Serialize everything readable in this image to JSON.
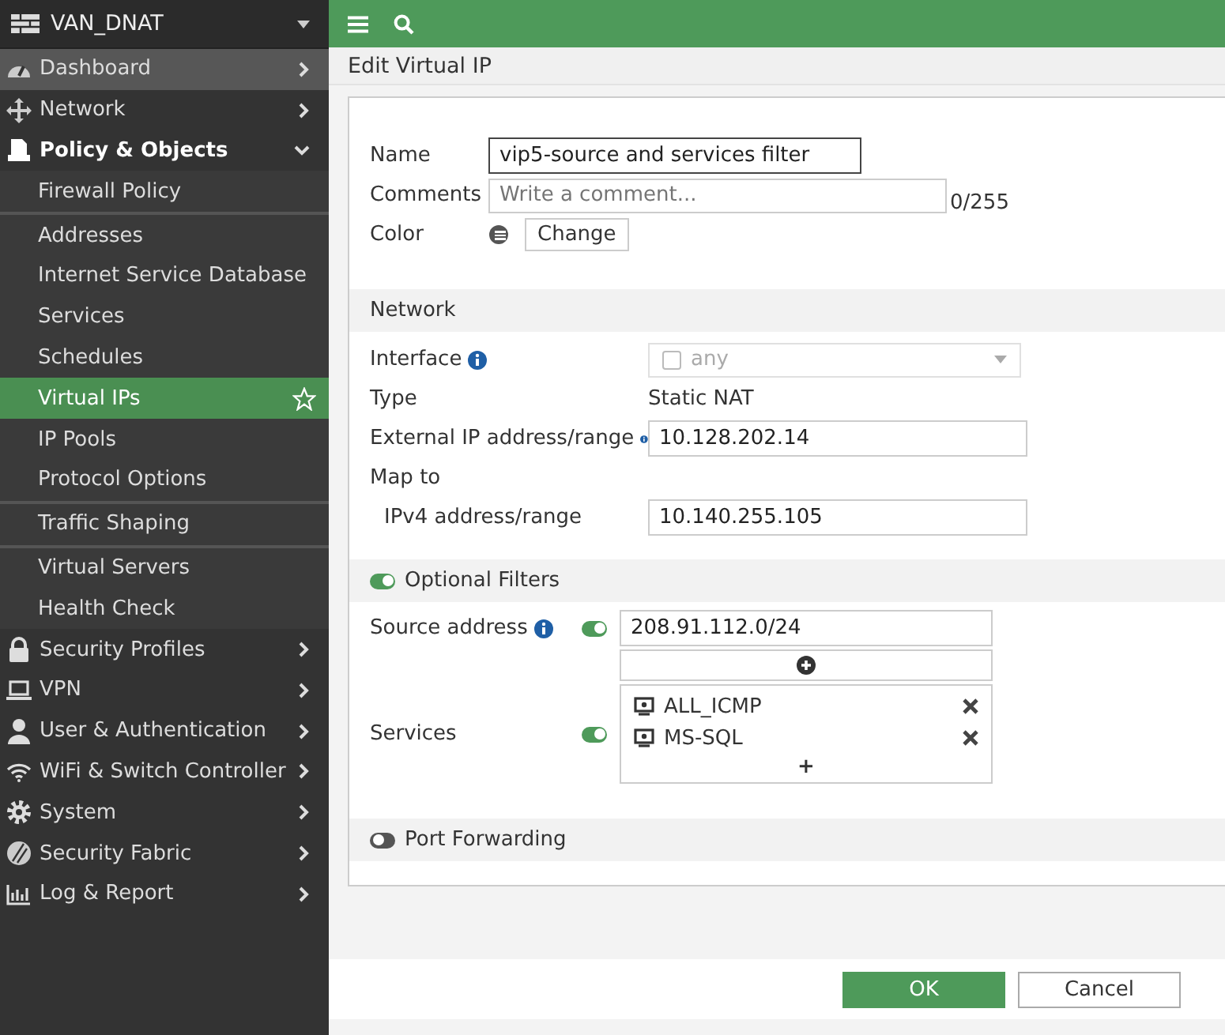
{
  "sidebar": {
    "device": "VAN_DNAT",
    "items": [
      {
        "label": "Dashboard",
        "hovered": true,
        "expanded": false,
        "selected": false
      },
      {
        "label": "Network",
        "hovered": false,
        "expanded": false,
        "selected": false
      },
      {
        "label": "Policy & Objects",
        "hovered": false,
        "expanded": true,
        "selected": false,
        "groups": [
          [
            {
              "label": "Firewall Policy",
              "selected": false
            }
          ],
          [
            {
              "label": "Addresses",
              "selected": false
            },
            {
              "label": "Internet Service Database",
              "selected": false
            },
            {
              "label": "Services",
              "selected": false
            },
            {
              "label": "Schedules",
              "selected": false
            },
            {
              "label": "Virtual IPs",
              "selected": true
            },
            {
              "label": "IP Pools",
              "selected": false
            },
            {
              "label": "Protocol Options",
              "selected": false
            }
          ],
          [
            {
              "label": "Traffic Shaping",
              "selected": false
            }
          ],
          [
            {
              "label": "Virtual Servers",
              "selected": false
            },
            {
              "label": "Health Check",
              "selected": false
            }
          ]
        ]
      },
      {
        "label": "Security Profiles",
        "hovered": false,
        "expanded": false,
        "selected": false
      },
      {
        "label": "VPN",
        "hovered": false,
        "expanded": false,
        "selected": false
      },
      {
        "label": "User & Authentication",
        "hovered": false,
        "expanded": false,
        "selected": false
      },
      {
        "label": "WiFi & Switch Controller",
        "hovered": false,
        "expanded": false,
        "selected": false
      },
      {
        "label": "System",
        "hovered": false,
        "expanded": false,
        "selected": false
      },
      {
        "label": "Security Fabric",
        "hovered": false,
        "expanded": false,
        "selected": false
      },
      {
        "label": "Log & Report",
        "hovered": false,
        "expanded": false,
        "selected": false
      }
    ]
  },
  "page_title": "Edit Virtual IP",
  "general": {
    "name_label": "Name",
    "name_value": "vip5-source and services filter",
    "comments_label": "Comments",
    "comments_placeholder": "Write a comment...",
    "comments_counter": "0/255",
    "color_label": "Color",
    "color_button": "Change"
  },
  "network": {
    "title": "Network",
    "interface_label": "Interface",
    "interface_value": "any",
    "interface_disabled": true,
    "interface_checked": false,
    "type_label": "Type",
    "type_value": "Static NAT",
    "external_label": "External IP address/range",
    "external_value": "10.128.202.14",
    "map_label": "Map to",
    "ipv4_label": "IPv4 address/range",
    "ipv4_value": "10.140.255.105"
  },
  "optional_filters": {
    "title": "Optional Filters",
    "on": true,
    "source_label": "Source address",
    "source_on": true,
    "source_values": [
      "208.91.112.0/24"
    ],
    "services_label": "Services",
    "services_on": true,
    "services": [
      "ALL_ICMP",
      "MS-SQL"
    ],
    "add_symbol": "+"
  },
  "port_forwarding": {
    "title": "Port Forwarding",
    "on": false
  },
  "buttons": [
    {
      "label": "OK",
      "primary": true
    },
    {
      "label": "Cancel",
      "primary": false
    }
  ]
}
